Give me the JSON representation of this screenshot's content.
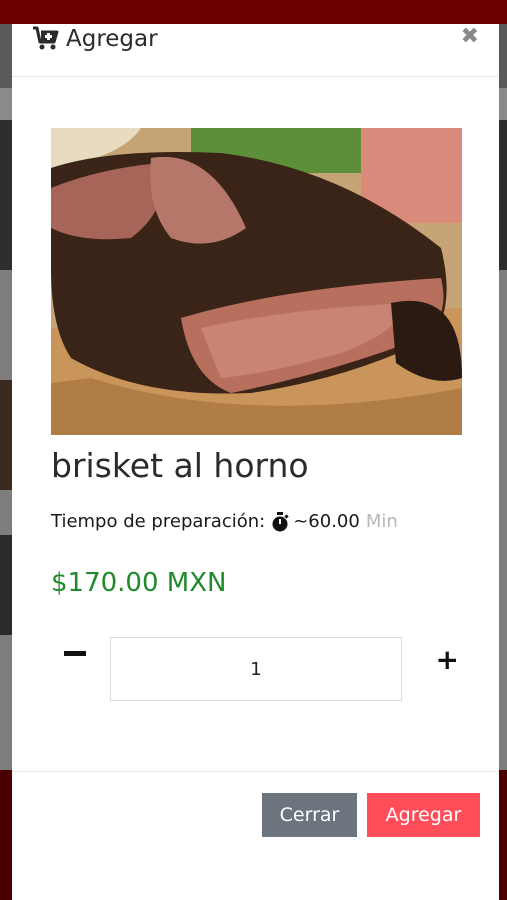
{
  "modal": {
    "title": "Agregar",
    "close_glyph": "✖",
    "icon": "cart-plus-icon"
  },
  "product": {
    "name": "brisket al horno",
    "image_alt_icon": "brisket-photo",
    "prep_label": "Tiempo de preparación:",
    "prep_icon": "stopwatch-icon",
    "prep_value": "~60.00",
    "prep_unit": "Min",
    "price": "$170.00 MXN"
  },
  "quantity": {
    "value": "1",
    "minus_icon": "minus-icon",
    "plus_glyph": "+"
  },
  "footer": {
    "close_label": "Cerrar",
    "add_label": "Agregar"
  },
  "colors": {
    "price": "#1f8a2b",
    "add_button": "#ff4d5a",
    "close_button": "#6c757d"
  }
}
